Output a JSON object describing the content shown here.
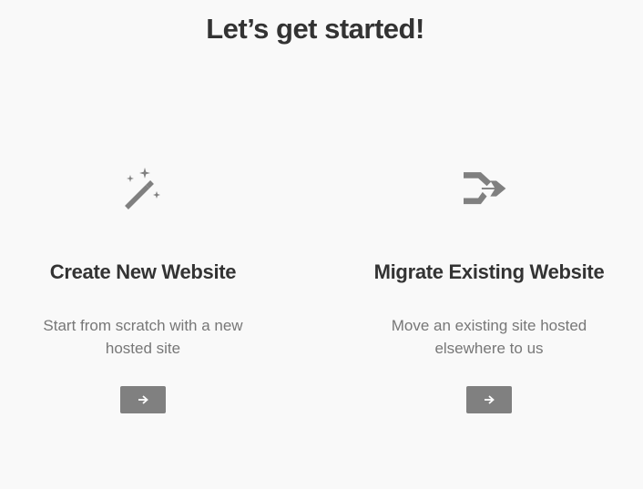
{
  "header": {
    "title": "Let’s get started!"
  },
  "cards": [
    {
      "icon": "magic-wand-icon",
      "title": "Create New Website",
      "description": "Start from scratch with a new hosted site",
      "button_icon": "arrow-right-icon"
    },
    {
      "icon": "merge-arrows-icon",
      "title": "Migrate Existing Website",
      "description": "Move an existing site hosted elsewhere to us",
      "button_icon": "arrow-right-icon"
    }
  ],
  "colors": {
    "background": "#f9f9f9",
    "heading": "#333333",
    "body_text": "#777777",
    "icon": "#808080",
    "button": "#808080",
    "button_icon": "#ffffff"
  }
}
